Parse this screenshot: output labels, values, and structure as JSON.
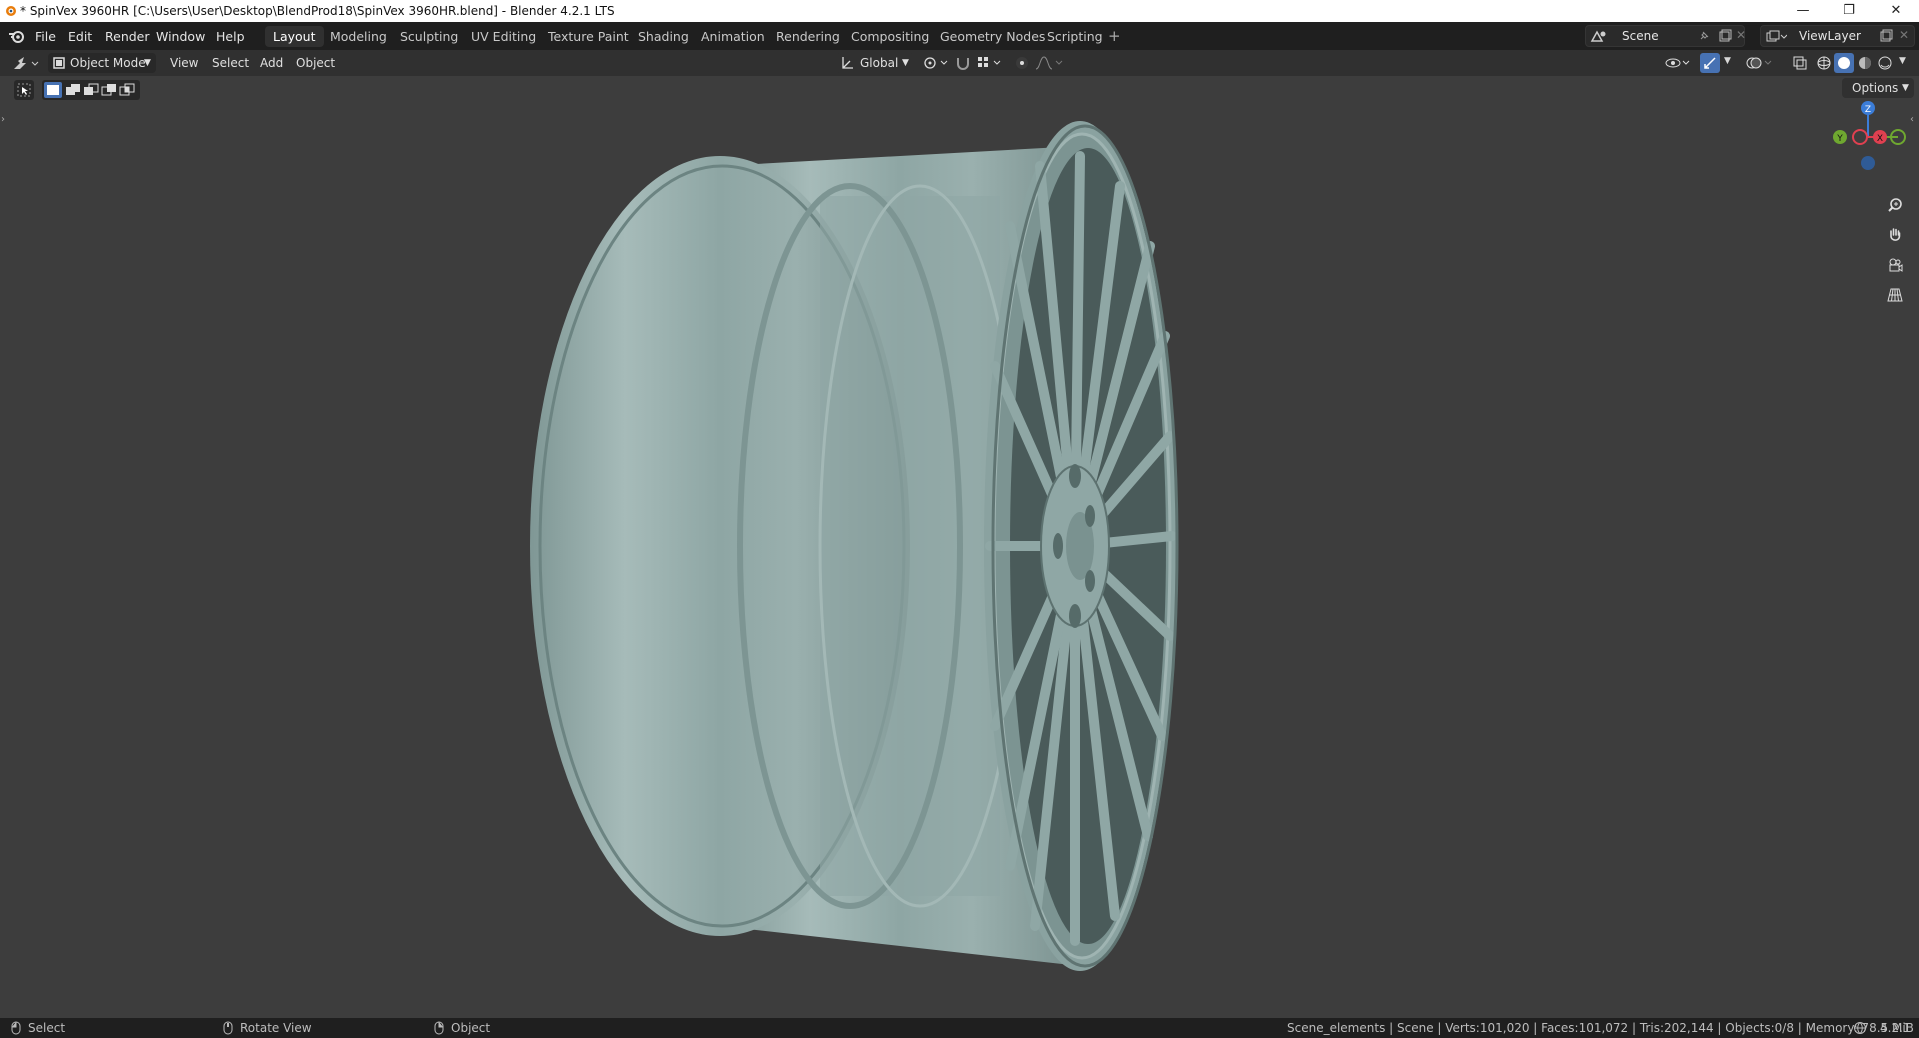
{
  "window": {
    "title": "* SpinVex 3960HR [C:\\Users\\User\\Desktop\\BlendProd18\\SpinVex 3960HR.blend] - Blender 4.2.1 LTS",
    "minimize": "—",
    "restore": "❐",
    "close": "✕"
  },
  "menu": [
    "File",
    "Edit",
    "Render",
    "Window",
    "Help"
  ],
  "workspaces": [
    "Layout",
    "Modeling",
    "Sculpting",
    "UV Editing",
    "Texture Paint",
    "Shading",
    "Animation",
    "Rendering",
    "Compositing",
    "Geometry Nodes",
    "Scripting"
  ],
  "active_workspace": "Layout",
  "scene": {
    "name": "Scene",
    "view_layer": "ViewLayer"
  },
  "viewport_header": {
    "mode": "Object Mode",
    "menus": [
      "View",
      "Select",
      "Add",
      "Object"
    ],
    "transform_orientation": "Global",
    "options": "Options"
  },
  "gizmo": {
    "z": "Z",
    "y": "Y",
    "x": "X"
  },
  "status": {
    "select": "Select",
    "rotate": "Rotate View",
    "object": "Object",
    "stats": "Scene_elements | Scene | Verts:101,020 | Faces:101,072 | Tris:202,144 | Objects:0/8 | Memory: 78.5 MiB |",
    "version": "4.2.1"
  },
  "colors": {
    "accent": "#4772b3",
    "x_axis": "#e04050",
    "y_axis": "#6fa830",
    "z_axis": "#3b7dd8",
    "wheel": "#8fa7a5"
  }
}
